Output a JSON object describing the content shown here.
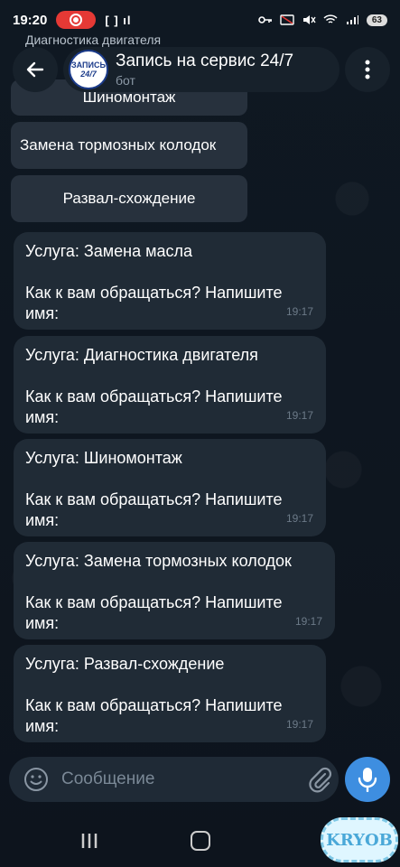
{
  "status_bar": {
    "time": "19:20",
    "small_icons": "[ ] ıl",
    "battery": "63"
  },
  "header": {
    "behind_text": "Диагностика двигателя",
    "title": "Запись на сервис 24/7",
    "subtitle": "бот",
    "avatar_top": "ЗАПИСЬ",
    "avatar_bottom": "24/7"
  },
  "keyboard": {
    "buttons": [
      {
        "label": "Шиномонтаж"
      },
      {
        "label": "Замена тормозных колодок"
      },
      {
        "label": "Развал-схождение"
      }
    ]
  },
  "messages": [
    {
      "service": "Услуга: Замена масла",
      "line1": "Как к вам обращаться? Напишите",
      "line2": "имя:",
      "time": "19:17"
    },
    {
      "service": "Услуга: Диагностика двигателя",
      "line1": "Как к вам обращаться? Напишите",
      "line2": "имя:",
      "time": "19:17"
    },
    {
      "service": "Услуга: Шиномонтаж",
      "line1": "Как к вам обращаться? Напишите",
      "line2": "имя:",
      "time": "19:17"
    },
    {
      "service": "Услуга: Замена тормозных колодок",
      "line1": "Как к вам обращаться? Напишите",
      "line2": "имя:",
      "time": "19:17"
    },
    {
      "service": "Услуга: Развал-схождение",
      "line1": "Как к вам обращаться? Напишите",
      "line2": "имя:",
      "time": "19:17"
    }
  ],
  "input": {
    "placeholder": "Сообщение"
  },
  "watermark": "KRYOB",
  "colors": {
    "background": "#0e1621",
    "bubble": "#202b36",
    "keyboard_button": "#27313d",
    "accent": "#3e8ee0",
    "record": "#e53935"
  },
  "icons": {
    "back": "arrow-left-icon",
    "menu": "more-vertical-icon",
    "emoji": "smile-icon",
    "attach": "paperclip-icon",
    "mic": "microphone-icon"
  }
}
